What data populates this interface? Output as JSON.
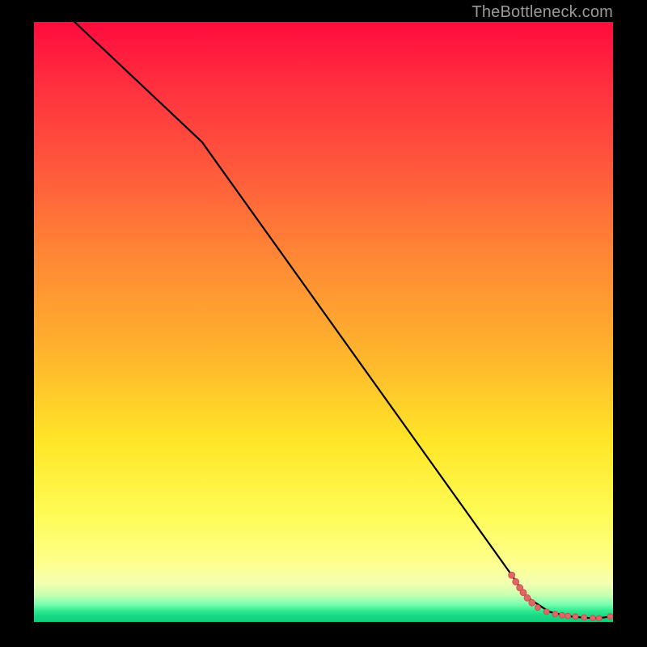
{
  "watermark": "TheBottleneck.com",
  "colors": {
    "line": "#000000",
    "marker_fill": "#e06666",
    "marker_stroke": "#c74b4b"
  },
  "chart_data": {
    "type": "line",
    "title": "",
    "xlabel": "",
    "ylabel": "",
    "xlim": [
      0,
      100
    ],
    "ylim": [
      0,
      100
    ],
    "grid": false,
    "legend": null,
    "series": [
      {
        "name": "curve",
        "style": "line",
        "x": [
          7,
          29,
          82.5,
          85,
          89,
          92,
          95,
          97.5,
          99.5
        ],
        "y": [
          100,
          80,
          7.8,
          4.2,
          1.7,
          1.0,
          0.7,
          0.6,
          0.9
        ]
      },
      {
        "name": "markers",
        "style": "scatter",
        "points": [
          {
            "x": 82.5,
            "y": 7.8,
            "r": 4
          },
          {
            "x": 83.2,
            "y": 6.7,
            "r": 4
          },
          {
            "x": 83.9,
            "y": 5.7,
            "r": 4
          },
          {
            "x": 84.5,
            "y": 4.9,
            "r": 4
          },
          {
            "x": 85.2,
            "y": 4.0,
            "r": 4
          },
          {
            "x": 86.0,
            "y": 3.2,
            "r": 4
          },
          {
            "x": 87.0,
            "y": 2.4,
            "r": 3.5
          },
          {
            "x": 88.5,
            "y": 1.7,
            "r": 3.5
          },
          {
            "x": 90.0,
            "y": 1.3,
            "r": 3.5
          },
          {
            "x": 91.2,
            "y": 1.1,
            "r": 3.5
          },
          {
            "x": 92.2,
            "y": 1.0,
            "r": 3.5
          },
          {
            "x": 93.5,
            "y": 0.9,
            "r": 3.5
          },
          {
            "x": 95.0,
            "y": 0.75,
            "r": 3.5
          },
          {
            "x": 96.5,
            "y": 0.65,
            "r": 3.5
          },
          {
            "x": 97.6,
            "y": 0.6,
            "r": 3.5
          },
          {
            "x": 99.5,
            "y": 0.9,
            "r": 3.5
          }
        ]
      }
    ]
  }
}
